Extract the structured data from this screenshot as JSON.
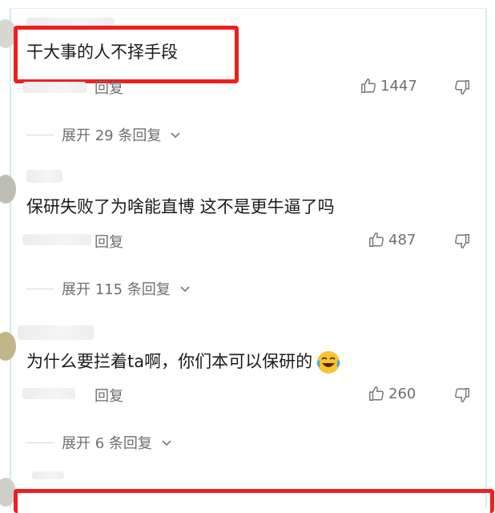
{
  "comments": [
    {
      "text": "干大事的人不择手段",
      "reply_label": "回复",
      "likes": "1447",
      "expand_label": "展开 29 条回复"
    },
    {
      "text": "保研失败了为啥能直博 这不是更牛逼了吗",
      "reply_label": "回复",
      "likes": "487",
      "expand_label": "展开 115 条回复"
    },
    {
      "text": "为什么要拦着ta啊，你们本可以保研的",
      "reply_label": "回复",
      "likes": "260",
      "expand_label": "展开 6 条回复"
    }
  ],
  "icons": {
    "like": "thumbs-up-icon",
    "dislike": "thumbs-down-icon",
    "expand": "chevron-down-icon",
    "emoji": "laughing-emoji-icon"
  },
  "colors": {
    "highlight": "#ee1f1f",
    "meta_text": "#6f6f6f",
    "frame": "#cfeef0"
  }
}
